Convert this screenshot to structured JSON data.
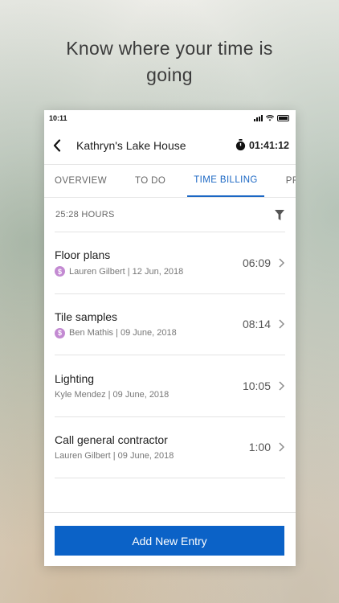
{
  "headline": {
    "line1": "Know where your time is",
    "line2": "going"
  },
  "status_bar": {
    "time": "10:11"
  },
  "header": {
    "title": "Kathryn's Lake House",
    "timer": "01:41:12",
    "back_icon": "chevron-left-icon",
    "timer_icon": "stopwatch-icon"
  },
  "tabs": [
    {
      "label": "OVERVIEW",
      "active": false
    },
    {
      "label": "TO DO",
      "active": false
    },
    {
      "label": "TIME BILLING",
      "active": true
    },
    {
      "label": "PRODU",
      "active": false
    }
  ],
  "summary": {
    "total": "25:28 HOURS",
    "filter_icon": "filter-icon"
  },
  "entries": [
    {
      "title": "Floor plans",
      "meta": "Lauren Gilbert | 12 Jun, 2018",
      "time": "06:09",
      "billable": true
    },
    {
      "title": "Tile samples",
      "meta": "Ben Mathis | 09 June, 2018",
      "time": "08:14",
      "billable": true
    },
    {
      "title": "Lighting",
      "meta": "Kyle Mendez | 09 June, 2018",
      "time": "10:05",
      "billable": false
    },
    {
      "title": "Call general contractor",
      "meta": "Lauren Gilbert | 09 June, 2018",
      "time": "1:00",
      "billable": false
    }
  ],
  "footer": {
    "add_label": "Add New Entry"
  },
  "colors": {
    "accent": "#0b62c7",
    "tab_active": "#1b67c4",
    "billable_badge": "#c38ad2"
  },
  "billable_symbol": "$"
}
